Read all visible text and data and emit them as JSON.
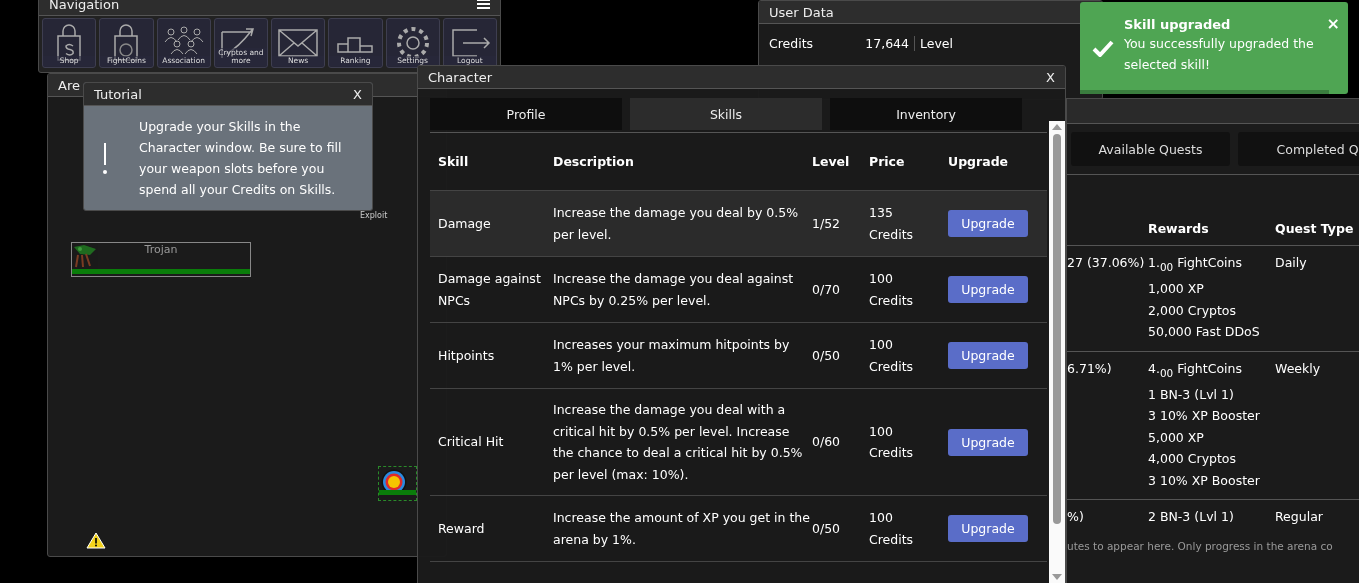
{
  "navigation": {
    "title": "Navigation",
    "buttons": [
      {
        "label": "Shop",
        "kind": "shop"
      },
      {
        "label": "FightCoins",
        "kind": "coins"
      },
      {
        "label": "Association",
        "kind": "people"
      },
      {
        "label": "Cryptos and more",
        "kind": "chart"
      },
      {
        "label": "News",
        "kind": "mail"
      },
      {
        "label": "Ranking",
        "kind": "podium"
      },
      {
        "label": "Settings",
        "kind": "gear"
      },
      {
        "label": "Logout",
        "kind": "logout"
      }
    ]
  },
  "arena": {
    "title": "Are",
    "exploit_label": "Exploit",
    "enemy": {
      "name": "Trojan",
      "level": 1.0
    },
    "target": {
      "level": 1.0
    }
  },
  "tutorial": {
    "title": "Tutorial",
    "close": "X",
    "text": "Upgrade your Skills in the Character window. Be sure to fill your weapon slots before you spend all your Credits on Skills."
  },
  "user_data": {
    "title": "User Data",
    "rows": [
      {
        "label": "Credits",
        "value": "17,644"
      }
    ],
    "right_label": "Level"
  },
  "quests": {
    "tabs": [
      {
        "label": "Available Quests",
        "selected": false
      },
      {
        "label": "Completed Q",
        "selected": false
      }
    ],
    "columns": [
      "Rewards",
      "Quest Type"
    ],
    "rows": [
      {
        "progress": "27 (37.06%)",
        "rewards": [
          "1.$_{00}$ FightCoins",
          "1,000 XP",
          "2,000 Cryptos",
          "50,000 Fast DDoS"
        ],
        "type": "Daily"
      },
      {
        "progress": "6.71%)",
        "rewards": [
          "4.$_{00}$ FightCoins",
          "1 BN-3 (Lvl 1)",
          "3 10% XP Booster",
          "5,000 XP",
          "4,000 Cryptos",
          "3 10% XP Booster"
        ],
        "type": "Weekly"
      },
      {
        "progress": "%)",
        "rewards": [
          "2 BN-3 (Lvl 1)"
        ],
        "type": "Regular"
      }
    ],
    "footer": "utes to appear here. Only progress in the arena co"
  },
  "notification": {
    "title": "Skill upgraded",
    "message": "You successfully upgraded the selected skill!",
    "close": "×",
    "level": 0.93
  },
  "character": {
    "title": "Character",
    "close": "X",
    "tabs": [
      {
        "label": "Profile",
        "selected": false
      },
      {
        "label": "Skills",
        "selected": true
      },
      {
        "label": "Inventory",
        "selected": false
      }
    ],
    "columns": [
      "Skill",
      "Description",
      "Level",
      "Price",
      "Upgrade"
    ],
    "rows": [
      {
        "skill": "Damage",
        "description": "Increase the damage you deal by 0.5% per level.",
        "level": "1/52",
        "price": "135 Credits",
        "button": "Upgrade",
        "selected": true
      },
      {
        "skill": "Damage against NPCs",
        "description": "Increase the damage you deal against NPCs by 0.25% per level.",
        "level": "0/70",
        "price": "100 Credits",
        "button": "Upgrade",
        "selected": false
      },
      {
        "skill": "Hitpoints",
        "description": "Increases your maximum hitpoints by 1% per level.",
        "level": "0/50",
        "price": "100 Credits",
        "button": "Upgrade",
        "selected": false
      },
      {
        "skill": "Critical Hit",
        "description": "Increase the damage you deal with a critical hit by 0.5% per level. Increase the chance to deal a critical hit by 0.5% per level (max: 10%).",
        "level": "0/60",
        "price": "100 Credits",
        "button": "Upgrade",
        "selected": false
      },
      {
        "skill": "Reward",
        "description": "Increase the amount of XP you get in the arena by 1%.",
        "level": "0/50",
        "price": "100 Credits",
        "button": "Upgrade",
        "selected": false
      }
    ]
  }
}
